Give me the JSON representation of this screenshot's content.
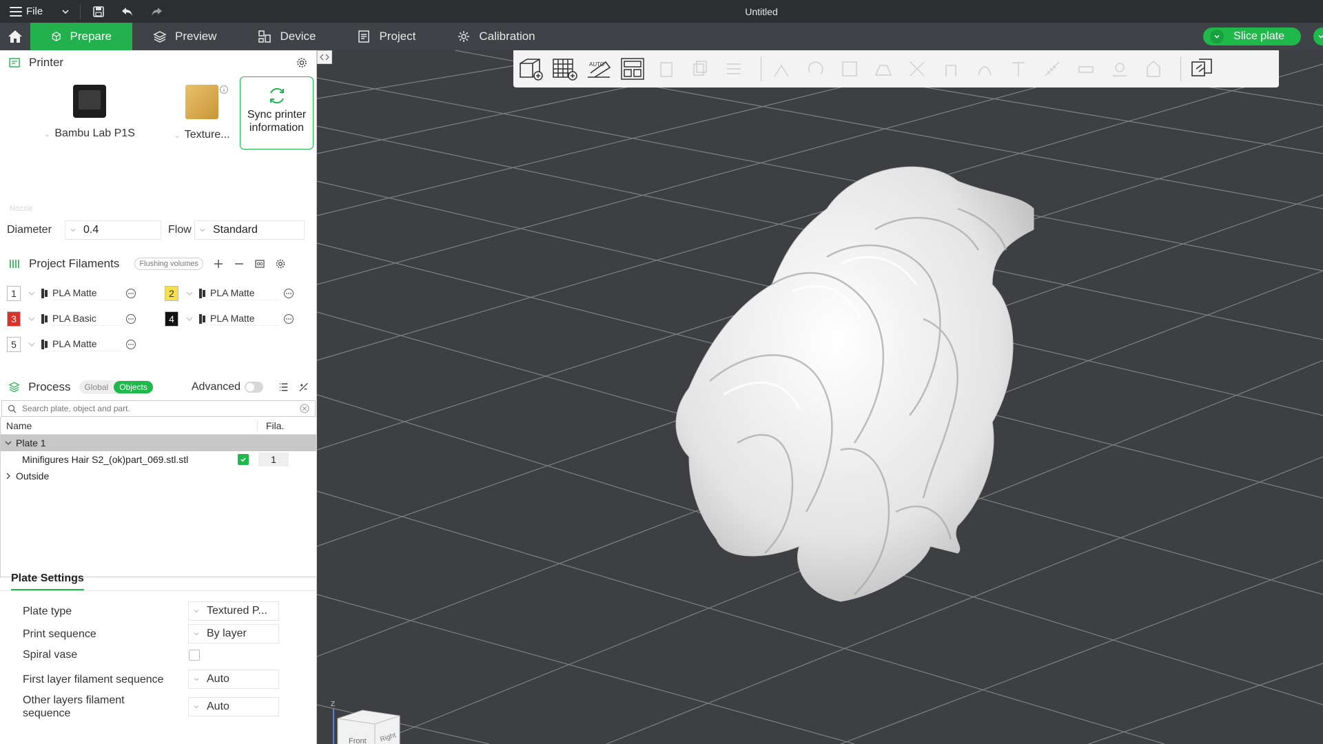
{
  "titlebar": {
    "menu_label": "File",
    "window_title": "Untitled"
  },
  "nav": {
    "tabs": [
      {
        "label": "Prepare",
        "icon": "cube-icon",
        "active": true
      },
      {
        "label": "Preview",
        "icon": "layers-icon",
        "active": false
      },
      {
        "label": "Device",
        "icon": "device-icon",
        "active": false
      },
      {
        "label": "Project",
        "icon": "project-icon",
        "active": false
      },
      {
        "label": "Calibration",
        "icon": "gear-icon",
        "active": false
      }
    ],
    "slice_label": "Slice plate",
    "accent": "#1fb84a"
  },
  "printer": {
    "section_title": "Printer",
    "printer_name": "Bambu Lab P1S",
    "plate_name": "Texture...",
    "sync_label_line1": "Sync printer",
    "sync_label_line2": "information",
    "faint_label": "Nozzle",
    "diameter_label": "Diameter",
    "diameter_value": "0.4",
    "flow_label": "Flow",
    "flow_value": "Standard"
  },
  "filaments": {
    "section_title": "Project Filaments",
    "flushing_label": "Flushing volumes",
    "items": [
      {
        "num": "1",
        "name": "PLA Matte",
        "color": "#ffffff",
        "text_color": "#333333"
      },
      {
        "num": "2",
        "name": "PLA Matte",
        "color": "#f5e04a",
        "text_color": "#333333"
      },
      {
        "num": "3",
        "name": "PLA Basic",
        "color": "#d9322b",
        "text_color": "#ffffff"
      },
      {
        "num": "4",
        "name": "PLA Matte",
        "color": "#111111",
        "text_color": "#ffffff"
      },
      {
        "num": "5",
        "name": "PLA Matte",
        "color": "#ffffff",
        "text_color": "#333333"
      }
    ]
  },
  "process": {
    "section_title": "Process",
    "seg_global": "Global",
    "seg_objects": "Objects",
    "advanced_label": "Advanced",
    "search_placeholder": "Search plate, object and part.",
    "col_name": "Name",
    "col_fila": "Fila.",
    "plate_label": "Plate 1",
    "object_name": "Minifigures Hair S2_(ok)part_069.stl.stl",
    "object_fila": "1",
    "outside_label": "Outside"
  },
  "plate_settings": {
    "tab_label": "Plate Settings",
    "rows": [
      {
        "label": "Plate type",
        "value": "Textured P..."
      },
      {
        "label": "Print sequence",
        "value": "By layer"
      },
      {
        "label": "Spiral vase",
        "value": ""
      },
      {
        "label": "First layer filament sequence",
        "value": "Auto"
      },
      {
        "label": "Other layers filament sequence",
        "value": "Auto"
      }
    ]
  },
  "viewport": {
    "cube_front": "Front",
    "cube_right": "Right",
    "axis_z": "Z"
  }
}
